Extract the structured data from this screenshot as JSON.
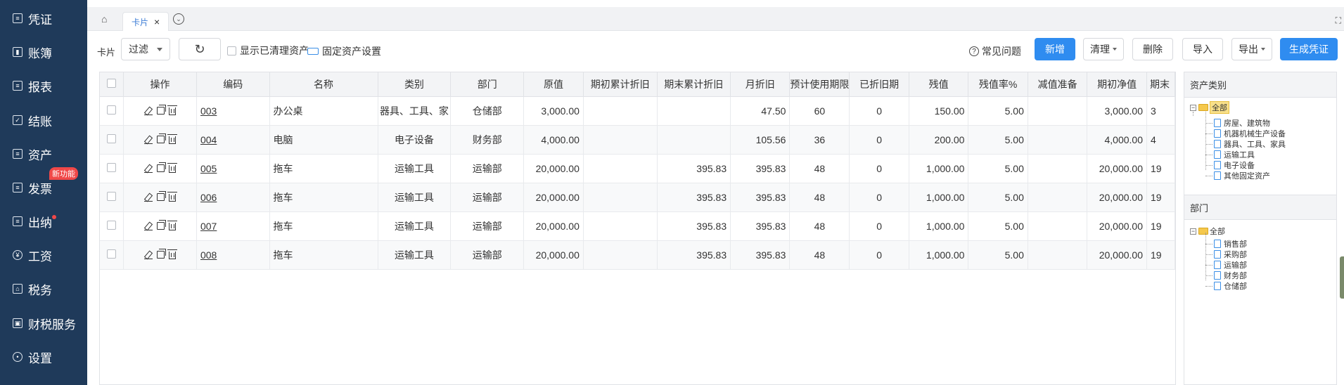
{
  "sidebar": {
    "items": [
      {
        "label": "凭证",
        "icon": "voucher-icon"
      },
      {
        "label": "账簿",
        "icon": "ledger-icon"
      },
      {
        "label": "报表",
        "icon": "report-icon"
      },
      {
        "label": "结账",
        "icon": "closing-icon"
      },
      {
        "label": "资产",
        "icon": "asset-icon"
      },
      {
        "label": "发票",
        "icon": "invoice-icon"
      },
      {
        "label": "出纳",
        "icon": "cashier-icon"
      },
      {
        "label": "工资",
        "icon": "salary-icon"
      },
      {
        "label": "税务",
        "icon": "tax-icon"
      },
      {
        "label": "财税服务",
        "icon": "finance-service-icon"
      },
      {
        "label": "设置",
        "icon": "settings-icon"
      }
    ],
    "invoice_badge": "新功能",
    "colors": {
      "bg": "#1f3a5a",
      "badge": "#f04848"
    }
  },
  "tabs": {
    "active": "卡片",
    "close": "×"
  },
  "toolbar": {
    "card_label": "卡片",
    "filter_value": "过滤",
    "show_cleared": "显示已清理资产",
    "asset_settings": "固定资产设置",
    "faq": "常见问题",
    "add": "新增",
    "clear": "清理",
    "delete": "删除",
    "import": "导入",
    "export": "导出",
    "generate_voucher": "生成凭证",
    "primary_color": "#2f8cf0"
  },
  "table": {
    "headers": [
      "操作",
      "编码",
      "名称",
      "类别",
      "部门",
      "原值",
      "期初累计折旧",
      "期末累计折旧",
      "月折旧",
      "预计使用期限",
      "已折旧期",
      "残值",
      "残值率%",
      "减值准备",
      "期初净值",
      "期末"
    ],
    "rows": [
      {
        "code": "003",
        "name": "办公桌",
        "category": "器具、工具、家",
        "dept": "仓储部",
        "original": "3,000.00",
        "open_dep": "",
        "end_dep": "",
        "monthly": "47.50",
        "life": "60",
        "used": "0",
        "residual": "150.00",
        "rate": "5.00",
        "impair": "",
        "open_net": "3,000.00",
        "end_net": "3"
      },
      {
        "code": "004",
        "name": "电脑",
        "category": "电子设备",
        "dept": "财务部",
        "original": "4,000.00",
        "open_dep": "",
        "end_dep": "",
        "monthly": "105.56",
        "life": "36",
        "used": "0",
        "residual": "200.00",
        "rate": "5.00",
        "impair": "",
        "open_net": "4,000.00",
        "end_net": "4"
      },
      {
        "code": "005",
        "name": "拖车",
        "category": "运输工具",
        "dept": "运输部",
        "original": "20,000.00",
        "open_dep": "",
        "end_dep": "395.83",
        "monthly": "395.83",
        "life": "48",
        "used": "0",
        "residual": "1,000.00",
        "rate": "5.00",
        "impair": "",
        "open_net": "20,000.00",
        "end_net": "19"
      },
      {
        "code": "006",
        "name": "拖车",
        "category": "运输工具",
        "dept": "运输部",
        "original": "20,000.00",
        "open_dep": "",
        "end_dep": "395.83",
        "monthly": "395.83",
        "life": "48",
        "used": "0",
        "residual": "1,000.00",
        "rate": "5.00",
        "impair": "",
        "open_net": "20,000.00",
        "end_net": "19"
      },
      {
        "code": "007",
        "name": "拖车",
        "category": "运输工具",
        "dept": "运输部",
        "original": "20,000.00",
        "open_dep": "",
        "end_dep": "395.83",
        "monthly": "395.83",
        "life": "48",
        "used": "0",
        "residual": "1,000.00",
        "rate": "5.00",
        "impair": "",
        "open_net": "20,000.00",
        "end_net": "19"
      },
      {
        "code": "008",
        "name": "拖车",
        "category": "运输工具",
        "dept": "运输部",
        "original": "20,000.00",
        "open_dep": "",
        "end_dep": "395.83",
        "monthly": "395.83",
        "life": "48",
        "used": "0",
        "residual": "1,000.00",
        "rate": "5.00",
        "impair": "",
        "open_net": "20,000.00",
        "end_net": "19"
      }
    ]
  },
  "right_panel": {
    "asset_category_title": "资产类别",
    "asset_root": "全部",
    "asset_children": [
      "房屋、建筑物",
      "机器机械生产设备",
      "器具、工具、家具",
      "运输工具",
      "电子设备",
      "其他固定资产"
    ],
    "dept_title": "部门",
    "dept_root": "全部",
    "dept_children": [
      "销售部",
      "采购部",
      "运输部",
      "财务部",
      "仓储部"
    ]
  }
}
